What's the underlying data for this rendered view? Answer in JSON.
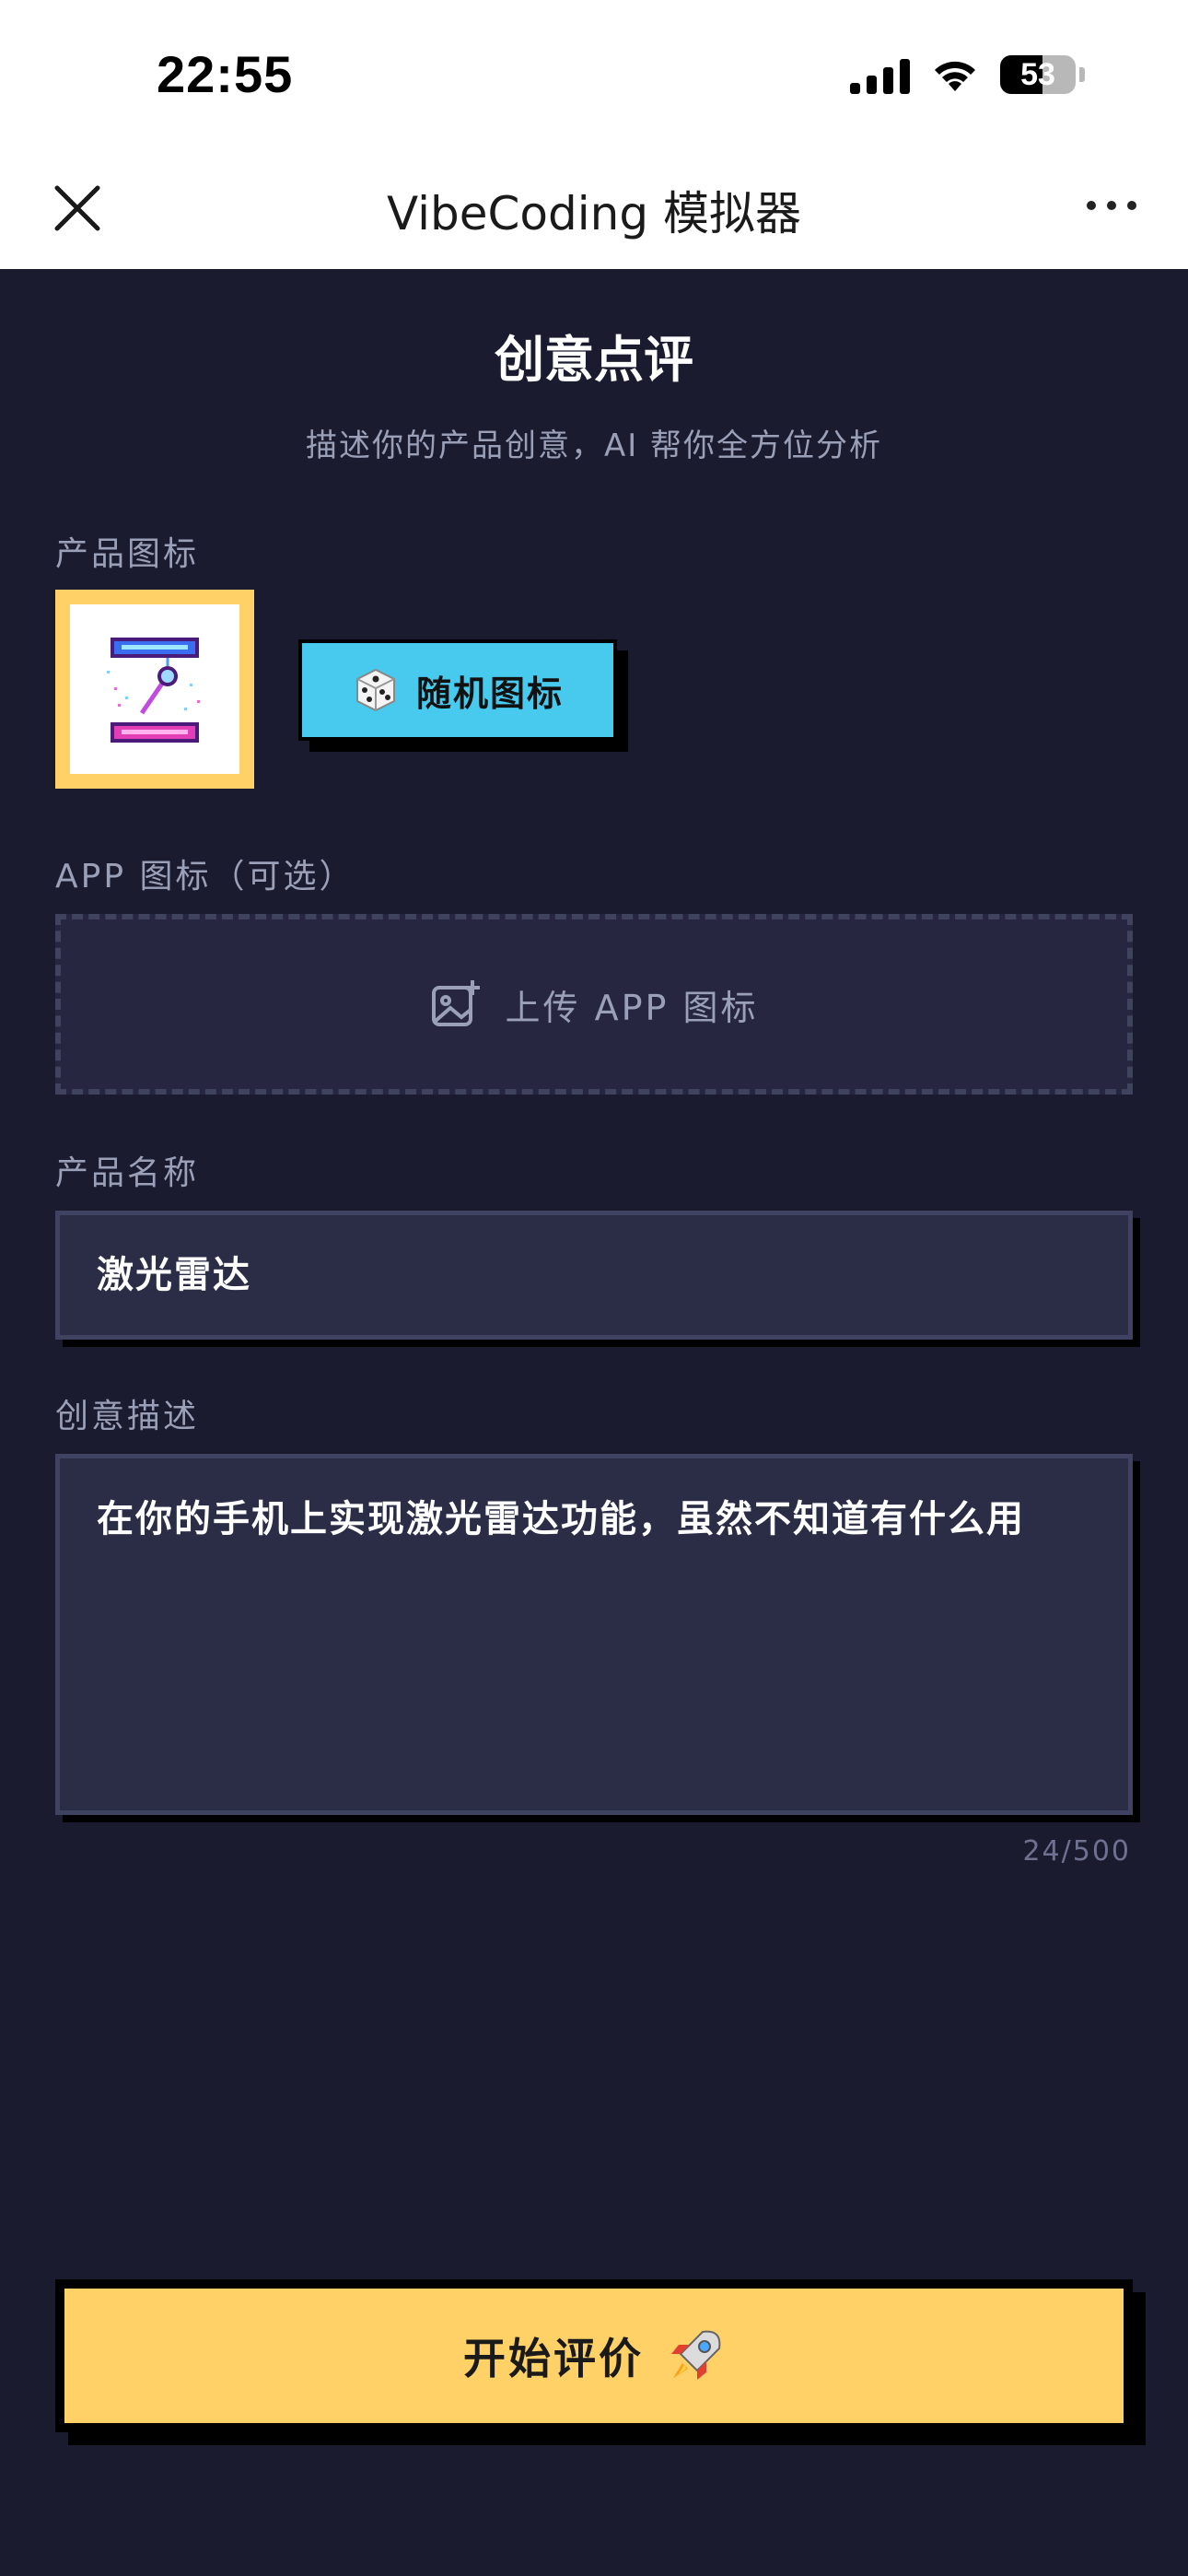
{
  "status_bar": {
    "time": "22:55",
    "battery": "53"
  },
  "nav": {
    "title": "VibeCoding 模拟器"
  },
  "page": {
    "title": "创意点评",
    "subtitle": "描述你的产品创意，AI 帮你全方位分析"
  },
  "product_icon": {
    "label": "产品图标",
    "random_button": "随机图标"
  },
  "app_icon": {
    "label": "APP 图标（可选）",
    "upload_text": "上传 APP 图标"
  },
  "product_name": {
    "label": "产品名称",
    "value": "激光雷达"
  },
  "description": {
    "label": "创意描述",
    "value": "在你的手机上实现激光雷达功能，虽然不知道有什么用",
    "counter": "24/500"
  },
  "submit": {
    "label": "开始评价",
    "icon": "rocket-icon"
  },
  "colors": {
    "background": "#1b1b2f",
    "accent_yellow": "#ffd166",
    "accent_blue": "#48c9ee",
    "field_bg": "#2b2d47"
  }
}
